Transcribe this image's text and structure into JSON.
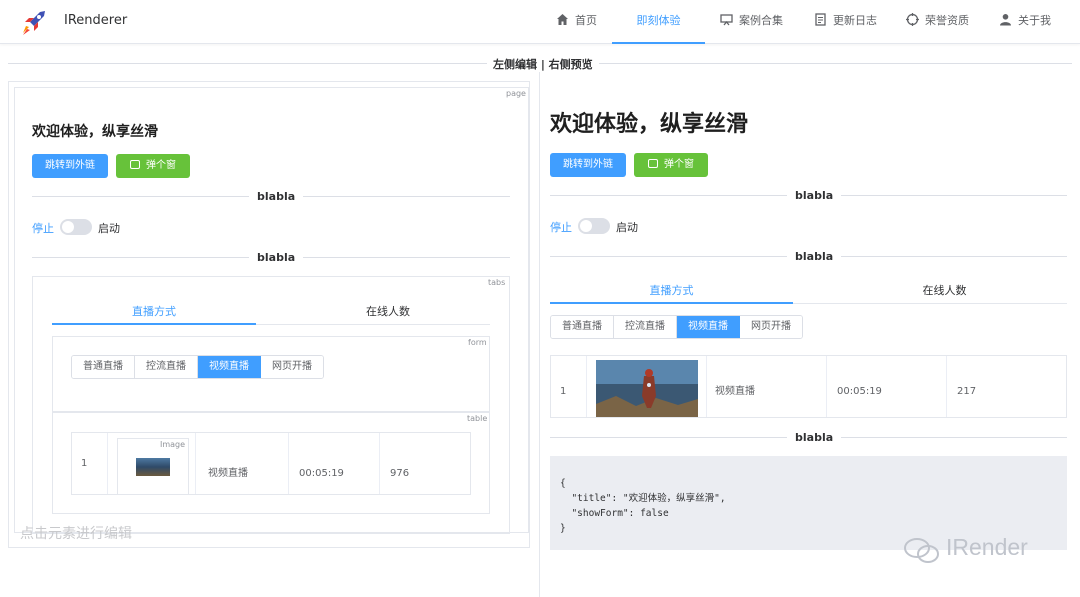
{
  "nav": {
    "brand": "IRenderer",
    "items": [
      {
        "label": "首页",
        "icon": "home-icon"
      },
      {
        "label": "即刻体验",
        "icon": "",
        "active": true
      },
      {
        "label": "案例合集",
        "icon": "monitor-icon"
      },
      {
        "label": "更新日志",
        "icon": "document-icon"
      },
      {
        "label": "荣誉资质",
        "icon": "target-icon"
      },
      {
        "label": "关于我",
        "icon": "user-icon"
      }
    ]
  },
  "header_divider": "左侧编辑 | 右侧预览",
  "editor": {
    "page_tag": "page",
    "tabs_tag": "tabs",
    "form_tag": "form",
    "table_tag": "table",
    "image_tag": "Image",
    "placeholder": "点击元素进行编辑"
  },
  "content": {
    "title": "欢迎体验，纵享丝滑",
    "link_button": "跳转到外链",
    "dialog_button": "弹个窗",
    "divider1": "blabla",
    "divider2": "blabla",
    "divider3": "blabla",
    "switch_off": "停止",
    "switch_on": "启动",
    "tabs": [
      "直播方式",
      "在线人数"
    ],
    "radios": [
      "普通直播",
      "控流直播",
      "视频直播",
      "网页开播"
    ],
    "selected_radio": "视频直播",
    "table_left": {
      "index": "1",
      "type": "视频直播",
      "duration": "00:05:19",
      "count": "976"
    },
    "table_right": {
      "index": "1",
      "type": "视频直播",
      "duration": "00:05:19",
      "count": "217"
    },
    "json_preview": "{\n  \"title\": \"欢迎体验，纵享丝滑\",\n  \"showForm\": false\n}"
  },
  "watermark": "IRender",
  "colors": {
    "primary": "#409eff",
    "success": "#67c23a"
  }
}
